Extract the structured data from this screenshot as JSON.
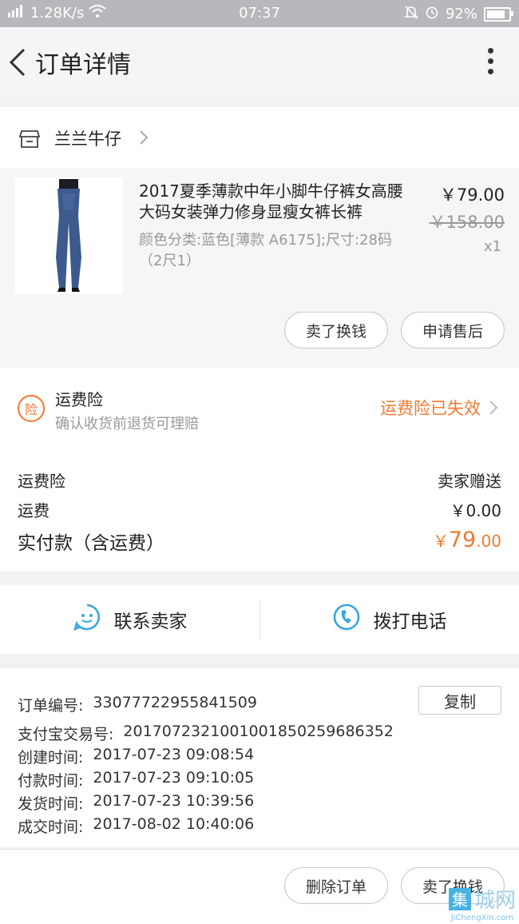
{
  "status": {
    "network": "1.28K/s",
    "time": "07:37",
    "battery": "92%"
  },
  "nav": {
    "title": "订单详情"
  },
  "shop": {
    "name": "兰兰牛仔"
  },
  "product": {
    "title": "2017夏季薄款中年小脚牛仔裤女高腰大码女装弹力修身显瘦女裤长裤",
    "spec": "颜色分类:蓝色[薄款 A6175];尺寸:28码（2尺1）",
    "price": "￥79.00",
    "original_price": "￥158.00",
    "qty": "x1",
    "btn_sell": "卖了换钱",
    "btn_after": "申请售后"
  },
  "insurance": {
    "badge": "险",
    "title": "运费险",
    "subtitle": "确认收货前退货可理赔",
    "status": "运费险已失效"
  },
  "fees": {
    "ins_label": "运费险",
    "ins_value": "卖家赠送",
    "ship_label": "运费",
    "ship_value": "￥0.00",
    "paid_label": "实付款（含运费）",
    "paid_symbol": "￥",
    "paid_int": "79",
    "paid_dec": ".00"
  },
  "contact": {
    "seller": "联系卖家",
    "call": "拨打电话"
  },
  "info": {
    "copy": "复制",
    "rows": [
      {
        "label": "订单编号:",
        "value": "330777229558415​09"
      },
      {
        "label": "支付宝交易号:",
        "value": "2017072321001001850259686352"
      },
      {
        "label": "创建时间:",
        "value": "2017-07-23 09:08:54"
      },
      {
        "label": "付款时间:",
        "value": "2017-07-23 09:10:05"
      },
      {
        "label": "发货时间:",
        "value": "2017-07-23 10:39:56"
      },
      {
        "label": "成交时间:",
        "value": "2017-08-02 10:40:06"
      }
    ]
  },
  "footer": {
    "delete": "删除订单",
    "sell": "卖了换钱"
  },
  "watermark": {
    "cn_box": "集",
    "cn": "城网",
    "en": "JiChengXin.com"
  },
  "colors": {
    "accent": "#ef7a31",
    "blue": "#3aa6e0"
  }
}
